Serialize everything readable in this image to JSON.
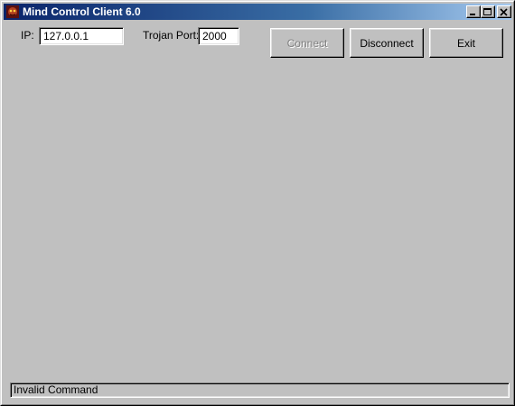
{
  "window": {
    "title": "Mind Control Client 6.0",
    "icon": "app-icon"
  },
  "titlebar_buttons": {
    "minimize": "minimize-icon",
    "maximize": "maximize-icon",
    "close": "close-icon"
  },
  "connection": {
    "ip_label": "IP:",
    "ip_value": "127.0.0.1",
    "port_label": "Trojan Port:",
    "port_value": "2000"
  },
  "buttons": {
    "connect": "Connect",
    "connect_enabled": false,
    "disconnect": "Disconnect",
    "exit": "Exit"
  },
  "status": {
    "text": "Invalid Command"
  },
  "colors": {
    "title_start": "#0a246a",
    "title_end": "#a6caf0",
    "face": "#c0c0c0"
  }
}
